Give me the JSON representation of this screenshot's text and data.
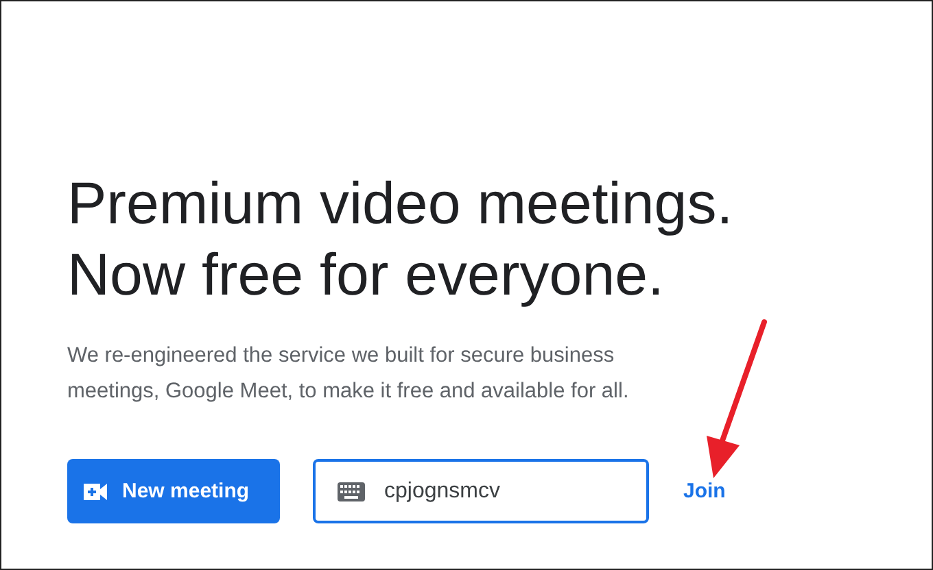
{
  "headline": [
    "Premium video meetings.",
    "Now free for everyone."
  ],
  "description": "We re-engineered the service we built for secure business meetings, Google Meet, to make it free and available for all.",
  "new_meeting_button": {
    "label": "New meeting"
  },
  "code_field": {
    "value": "cpjognsmcv"
  },
  "join_link": {
    "label": "Join"
  }
}
